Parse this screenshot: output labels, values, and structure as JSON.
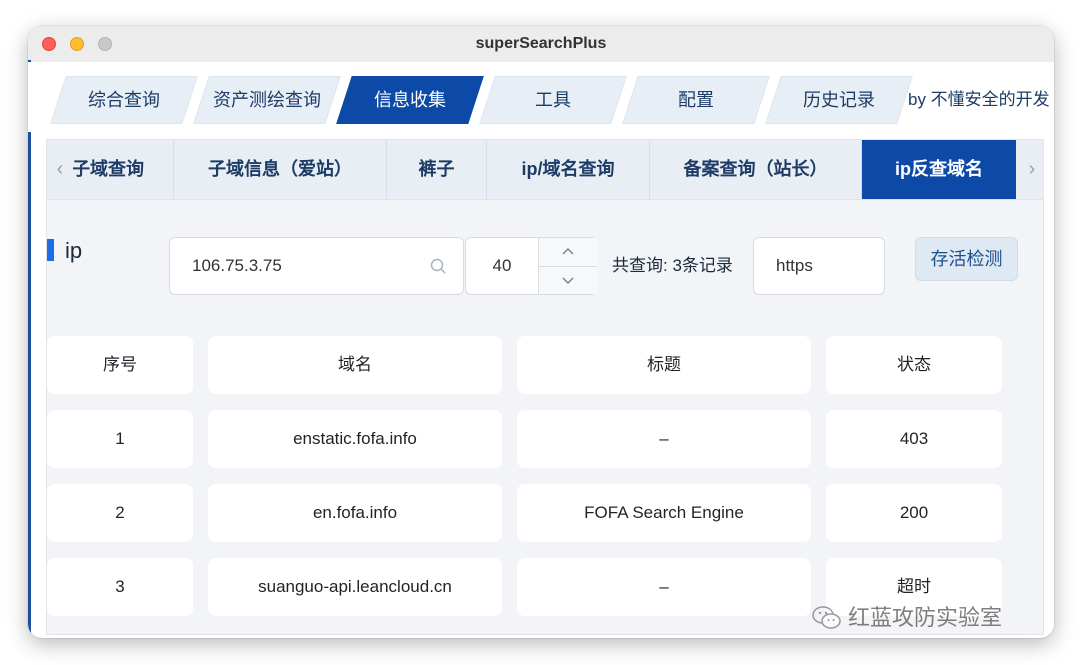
{
  "window": {
    "title": "superSearchPlus"
  },
  "main_tabs": [
    {
      "label": "综合查询"
    },
    {
      "label": "资产测绘查询"
    },
    {
      "label": "信息收集"
    },
    {
      "label": "工具"
    },
    {
      "label": "配置"
    },
    {
      "label": "历史记录"
    }
  ],
  "active_main_tab": "信息收集",
  "byline": "by 不懂安全的开发",
  "sub_tabs": [
    {
      "label": "子域查询"
    },
    {
      "label": "子域信息（爱站）"
    },
    {
      "label": "裤子"
    },
    {
      "label": "ip/域名查询"
    },
    {
      "label": "备案查询（站长）"
    },
    {
      "label": "ip反查域名"
    }
  ],
  "active_sub_tab": "ip反查域名",
  "query": {
    "label": "ip",
    "ip_value": "106.75.3.75",
    "count_value": "40",
    "total_text": "共查询: 3条记录",
    "protocol_value": "https",
    "alive_button": "存活检测"
  },
  "table": {
    "columns": [
      "序号",
      "域名",
      "标题",
      "状态"
    ],
    "rows": [
      [
        "1",
        "enstatic.fofa.info",
        "–",
        "403"
      ],
      [
        "2",
        "en.fofa.info",
        "FOFA Search Engine",
        "200"
      ],
      [
        "3",
        "suanguo-api.leancloud.cn",
        "–",
        "超时"
      ]
    ]
  },
  "watermark": "红蓝攻防实验室",
  "colors": {
    "accent": "#0d4aa8",
    "tab_bg": "#e8eef5",
    "panel_bg": "#f2f4f7"
  }
}
